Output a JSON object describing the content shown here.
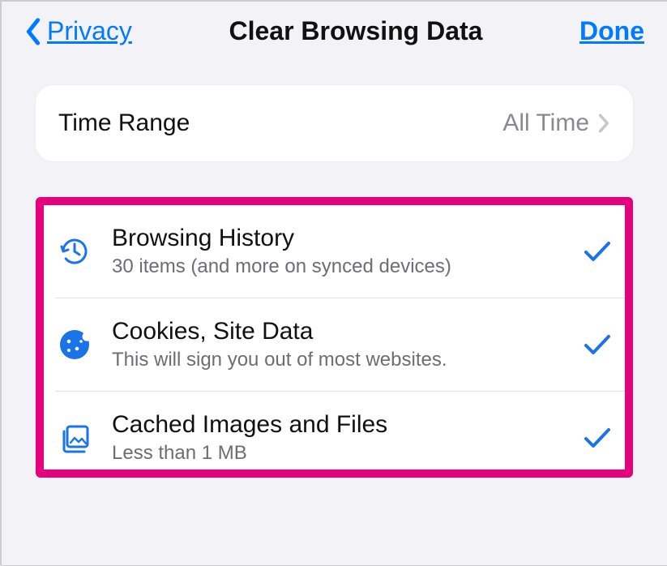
{
  "header": {
    "back_label": "Privacy",
    "title": "Clear Browsing Data",
    "done_label": "Done"
  },
  "time_range": {
    "label": "Time Range",
    "value": "All Time"
  },
  "options": [
    {
      "icon": "history-icon",
      "title": "Browsing History",
      "subtitle": "30 items (and more on synced devices)",
      "checked": true
    },
    {
      "icon": "cookie-icon",
      "title": "Cookies, Site Data",
      "subtitle": "This will sign you out of most websites.",
      "checked": true
    },
    {
      "icon": "image-stack-icon",
      "title": "Cached Images and Files",
      "subtitle": "Less than 1 MB",
      "checked": true
    }
  ],
  "colors": {
    "accent": "#007aff",
    "highlight": "#e6007e"
  }
}
